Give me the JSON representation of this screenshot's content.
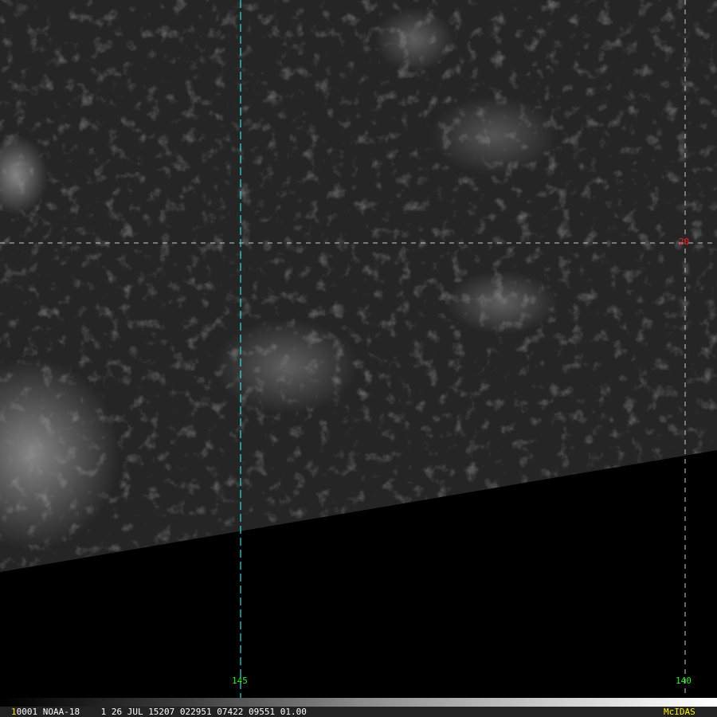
{
  "image": {
    "satellite": "NOAA-18"
  },
  "grid": {
    "lon_labels": [
      "145",
      "140"
    ],
    "lat_labels": [
      "20"
    ],
    "colors": {
      "lon_145": "#33dddd",
      "lon_label": "#33ee33",
      "lat_label": "#ff2020",
      "grid": "#cccccc"
    }
  },
  "status": {
    "frame": "1",
    "text": "0001 NOAA-18    1 26 JUL 15207 022951 07422 09551 01.00",
    "brand": "McIDAS"
  }
}
